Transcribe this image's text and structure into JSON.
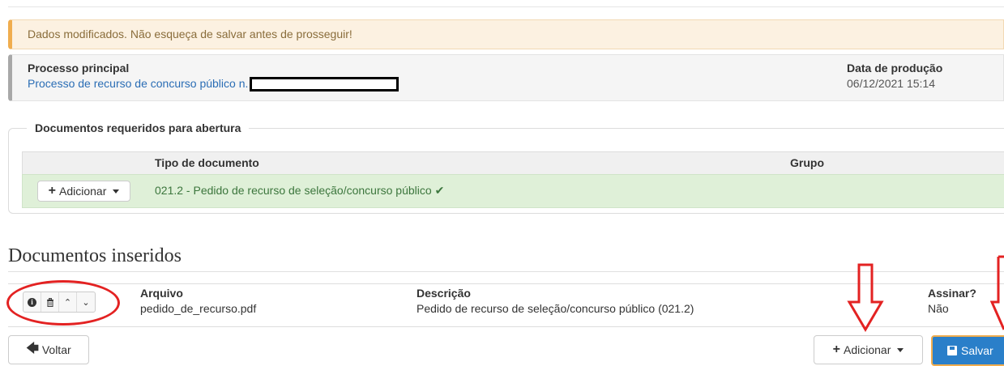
{
  "alert": {
    "text": "Dados modificados. Não esqueça de salvar antes de prosseguir!"
  },
  "process": {
    "label": "Processo principal",
    "value": "Processo de recurso de concurso público n.",
    "date_label": "Data de produção",
    "date_value": "06/12/2021 15:14"
  },
  "required_docs": {
    "legend": "Documentos requeridos para abertura",
    "columns": {
      "type": "Tipo de documento",
      "group": "Grupo"
    },
    "rows": [
      {
        "add_label": "Adicionar",
        "doc_type": "021.2 - Pedido de recurso de seleção/concurso público",
        "group": ""
      }
    ]
  },
  "inserted_docs": {
    "title": "Documentos inseridos",
    "columns": {
      "file": "Arquivo",
      "description": "Descrição",
      "sign": "Assinar?"
    },
    "rows": [
      {
        "file": "pedido_de_recurso.pdf",
        "description": "Pedido de recurso de seleção/concurso público (021.2)",
        "sign": "Não"
      }
    ]
  },
  "footer": {
    "back_label": "Voltar",
    "add_label": "Adicionar",
    "save_label": "Salvar"
  },
  "colors": {
    "alert_bg": "#fcf1e1",
    "success_bg": "#dff0d8",
    "primary": "#2a7fc9",
    "annotation_red": "#e32222"
  },
  "icons": [
    "plus-icon",
    "caret-down-icon",
    "check-icon",
    "info-icon",
    "trash-icon",
    "move-up-icon",
    "move-down-icon",
    "arrow-left-icon",
    "save-icon"
  ]
}
